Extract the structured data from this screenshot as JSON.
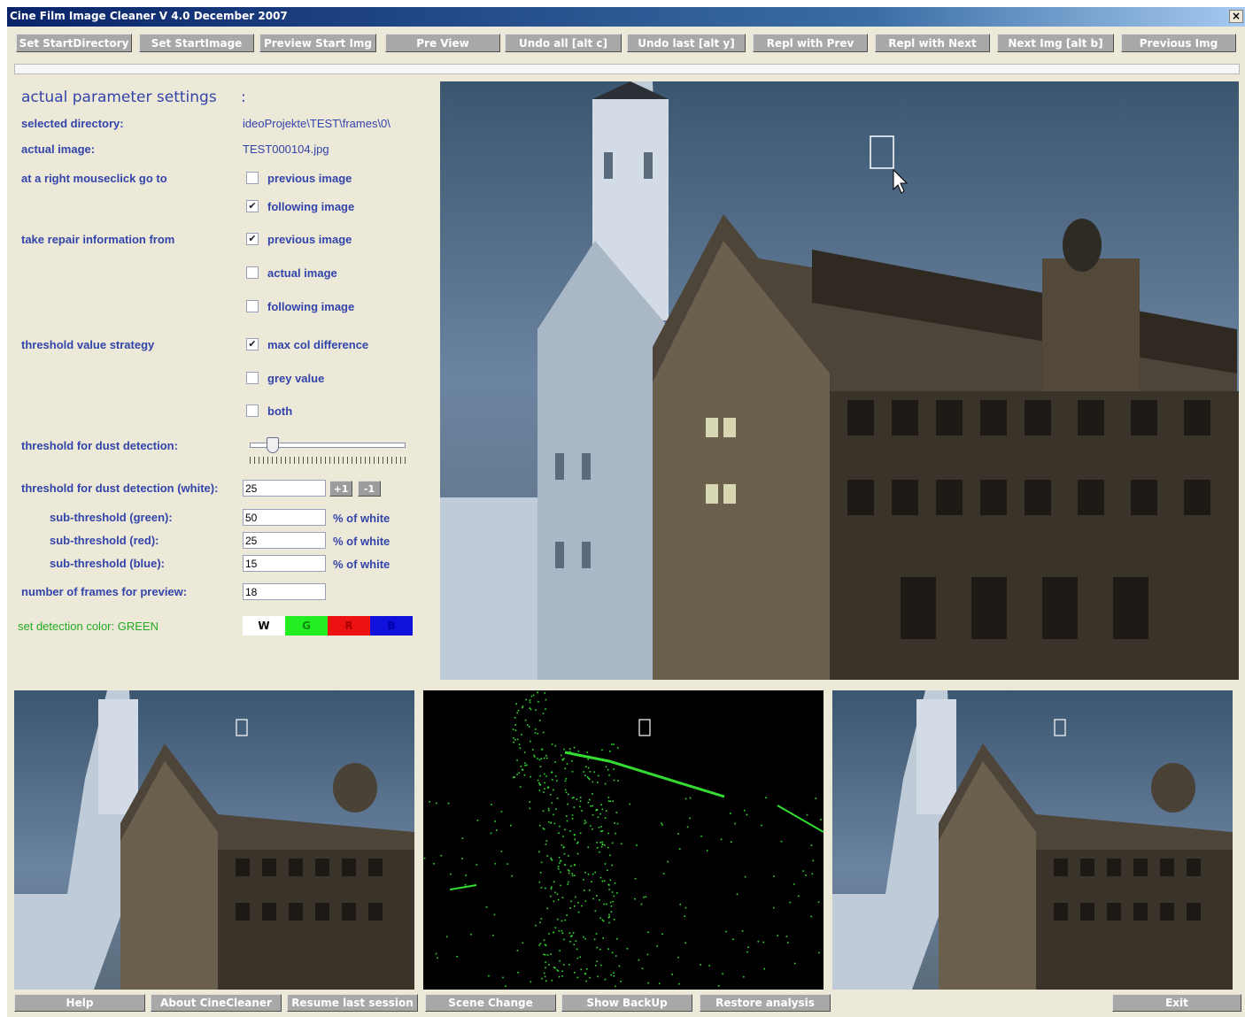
{
  "window": {
    "title": "Cine Film Image Cleaner V 4.0 December 2007",
    "close_label": "×"
  },
  "toolbar": {
    "buttons": [
      "Set StartDirectory",
      "Set StartImage",
      "Preview Start Img",
      "Pre View",
      "Undo all  [alt c]",
      "Undo last [alt y]",
      "Repl with Prev",
      "Repl with Next",
      "Next Img  [alt b]",
      "Previous Img"
    ]
  },
  "settings": {
    "header": "actual parameter settings",
    "header_colon": ":",
    "selected_directory_label": "selected directory:",
    "selected_directory_value": "ideoProjekte\\TEST\\frames\\0\\",
    "actual_image_label": "actual image:",
    "actual_image_value": "TEST000104.jpg",
    "right_click_label": "at a right mouseclick go to",
    "right_click_options": [
      {
        "label": "previous image",
        "checked": false
      },
      {
        "label": "following image",
        "checked": true
      }
    ],
    "repair_label": "take repair information from",
    "repair_options": [
      {
        "label": "previous image",
        "checked": true
      },
      {
        "label": "actual image",
        "checked": false
      },
      {
        "label": "following image",
        "checked": false
      }
    ],
    "strategy_label": "threshold value strategy",
    "strategy_options": [
      {
        "label": "max col difference",
        "checked": true
      },
      {
        "label": "grey value",
        "checked": false
      },
      {
        "label": "both",
        "checked": false
      }
    ],
    "check_mark": "✔",
    "dust_detection_label": "threshold for dust detection:",
    "dust_slider_level_percent": 15,
    "white_threshold_label": "threshold for dust detection (white):",
    "white_threshold_value": "25",
    "plus_label": "+1",
    "minus_label": "-1",
    "sub_green_label": "sub-threshold (green):",
    "sub_green_value": "50",
    "sub_red_label": "sub-threshold (red):",
    "sub_red_value": "25",
    "sub_blue_label": "sub-threshold (blue):",
    "sub_blue_value": "15",
    "pct_of_white": "% of white",
    "frames_preview_label": "number of frames for preview:",
    "frames_preview_value": "18",
    "detection_color_label": "set detection color: GREEN",
    "color_buttons": [
      {
        "label": "W",
        "bg": "#ffffff",
        "fg": "#000000"
      },
      {
        "label": "G",
        "bg": "#22ee22",
        "fg": "#118811"
      },
      {
        "label": "R",
        "bg": "#ee1111",
        "fg": "#aa0000"
      },
      {
        "label": "B",
        "bg": "#1111dd",
        "fg": "#0000aa"
      }
    ]
  },
  "colors": {
    "label_blue": "#3344aa",
    "detection_green": "#22aa22",
    "button_grey": "#a8a8a8",
    "dust_green": "#33dd33"
  },
  "bottom_bar": {
    "buttons": [
      "Help",
      "About CineCleaner",
      "Resume last session",
      "Scene Change",
      "Show BackUp",
      "Restore analysis"
    ],
    "exit_label": "Exit"
  }
}
